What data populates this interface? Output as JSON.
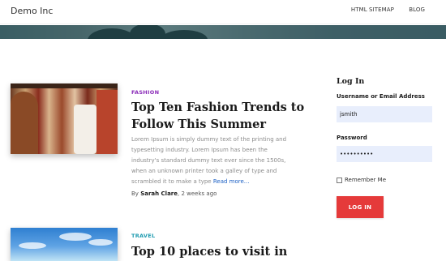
{
  "header": {
    "brand": "Demo Inc",
    "nav": [
      {
        "label": "HTML SITEMAP"
      },
      {
        "label": "BLOG"
      }
    ]
  },
  "posts": [
    {
      "category": "FASHION",
      "category_color": "#8a2bb8",
      "title_lines": [
        "Top Ten Fashion Trends to",
        "Follow This Summer"
      ],
      "excerpt_lines": [
        "Lorem Ipsum is simply dummy text of the printing and",
        "typesetting industry. Lorem Ipsum has been the",
        "industry's standard dummy text ever since the 1500s,",
        "when an unknown printer took a galley of type and",
        "scrambled it to make a type"
      ],
      "read_more": "Read more...",
      "meta_prefix": "By",
      "author": "Sarah Clare",
      "time": ", 2 weeks ago"
    },
    {
      "category": "TRAVEL",
      "category_color": "#1e9bb0",
      "title_lines": [
        "Top 10 places to visit in"
      ]
    }
  ],
  "login_widget": {
    "title": "Log In",
    "username_label": "Username or Email Address",
    "username_value": "jsmith",
    "password_label": "Password",
    "password_value": "••••••••••",
    "remember_label": "Remember Me",
    "button_label": "LOG IN",
    "button_color": "#e53a3a",
    "field_bg": "#e8eefc"
  }
}
